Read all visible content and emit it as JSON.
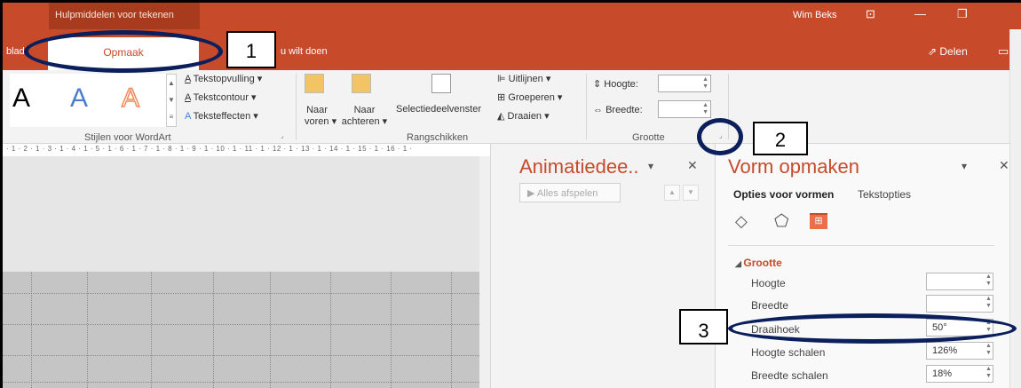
{
  "titlebar": {
    "context_tab": "Hulpmiddelen voor tekenen",
    "user": "Wim Beks"
  },
  "tabs": {
    "left_partial": "blad",
    "active": "Opmaak",
    "tell_me": "u wilt doen",
    "share": "Delen"
  },
  "ribbon": {
    "wordart_letters": [
      "A",
      "A",
      "A"
    ],
    "text_fill": "Tekstopvulling",
    "text_outline": "Tekstcontour",
    "text_effects": "Teksteffecten",
    "wordart_group": "Stijlen voor WordArt",
    "bring_forward_1": "Naar",
    "bring_forward_2": "voren",
    "send_back_1": "Naar",
    "send_back_2": "achteren",
    "selection_pane": "Selectiedeelvenster",
    "align": "Uitlijnen",
    "group": "Groeperen",
    "rotate": "Draaien",
    "arrange_group": "Rangschikken",
    "height_label": "Hoogte:",
    "width_label": "Breedte:",
    "size_group": "Grootte"
  },
  "ruler": {
    "text": "· 1 · 2 · 1 · 3 · 1 · 4 · 1 · 5 · 1 · 6 · 1 · 7 · 1 · 8 · 1 · 9 · 1 · 10 · 1 · 11 · 1 · 12 · 1 · 13 · 1 · 14 · 1 · 15 · 1 · 16 · 1 ·"
  },
  "animation_pane": {
    "title": "Animatiedee..",
    "play_all": "Alles afspelen"
  },
  "format_pane": {
    "title": "Vorm opmaken",
    "tab_shape": "Opties voor vormen",
    "tab_text": "Tekstopties",
    "section": "Grootte",
    "rows": [
      {
        "label": "Hoogte",
        "value": ""
      },
      {
        "label": "Breedte",
        "value": ""
      },
      {
        "label": "Draaihoek",
        "value": "50°"
      },
      {
        "label": "Hoogte schalen",
        "value": "126%"
      },
      {
        "label": "Breedte schalen",
        "value": "18%"
      }
    ]
  },
  "annotations": {
    "one": "1",
    "two": "2",
    "three": "3"
  },
  "colors": {
    "accent": "#c74a2a",
    "annotation_oval": "#0a1f5c"
  }
}
